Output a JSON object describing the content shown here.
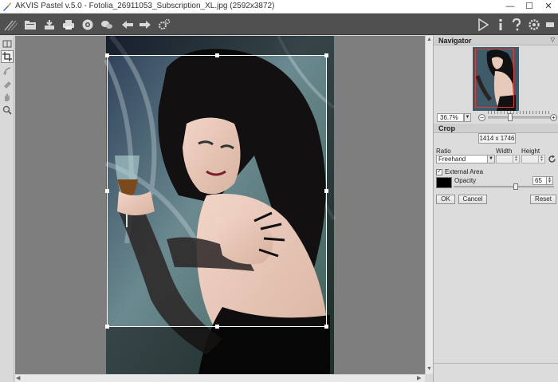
{
  "window": {
    "title": "AKVIS Pastel v.5.0 - Fotolia_26911053_Subscription_XL.jpg (2592x3872)",
    "minimize": "—",
    "maximize": "☐",
    "close": "✕"
  },
  "toolbar": {
    "icons": [
      "brush-logo-icon",
      "open-icon",
      "save-icon",
      "print-icon",
      "share-icon",
      "batch-icon",
      "undo-icon",
      "redo-icon",
      "settings-gear-icon",
      "run-icon",
      "info-icon",
      "help-icon",
      "preferences-icon",
      "panel-toggle-icon"
    ]
  },
  "navigator": {
    "title": "Navigator",
    "zoom": "36.7%",
    "zoom_out": "−",
    "zoom_in": "+"
  },
  "crop": {
    "title": "Crop",
    "size": "1414 x 1746",
    "ratio_label": "Ratio",
    "ratio_value": "Freehand",
    "width_label": "Width",
    "height_label": "Height",
    "external_area_label": "External Area",
    "external_area_checked": "✓",
    "external_color": "#000000",
    "opacity_label": "Opacity",
    "opacity_value": "65",
    "ok": "OK",
    "cancel": "Cancel",
    "reset": "Reset"
  },
  "colors": {
    "toolbar_bg": "#505050",
    "canvas_bg": "#7e7e7e",
    "crop_frame": "#ffffff",
    "navigator_frame": "#e23b3b"
  }
}
